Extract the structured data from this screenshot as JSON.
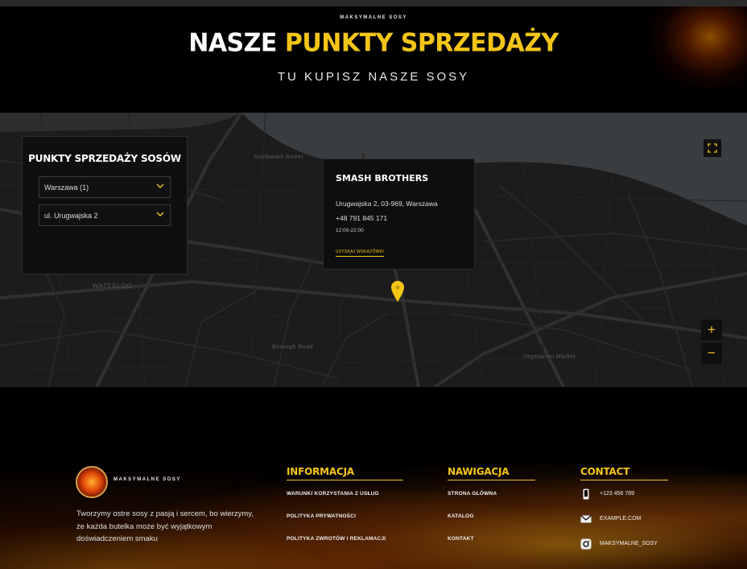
{
  "hero": {
    "brand": "MAKSYMALNE SOSY",
    "title_white": "NASZE",
    "title_yellow": "PUNKTY SPRZEDAŻY",
    "subtitle": "TU KUPISZ NASZE SOSY"
  },
  "map": {
    "labels": {
      "waterloo": "WATERLOO",
      "borough": "Borough Road",
      "vegetarian": "Vegetarian Market",
      "southwark": "Southwark Street"
    },
    "selector": {
      "title": "PUNKTY SPRZEDAŻY SOSÓW",
      "city_value": "Warszawa (1)",
      "street_value": "ul. Urugwajska 2"
    },
    "store": {
      "name": "SMASH BROTHERS",
      "address": "Urugwajska 2, 03-969, Warszawa",
      "phone": "+48 791 845 171",
      "hours": "12:00-22:00",
      "directions_label": "UZYSKAJ WSKAZÓWKI"
    },
    "zoom_in": "+",
    "zoom_out": "−"
  },
  "footer": {
    "brand": "MAKSYMALNE SOSY",
    "description": "Tworzymy ostre sosy z pasją i sercem, bo wierzymy, że każda butelka może być wyjątkowym doświadczeniem smaku",
    "info": {
      "heading": "INFORMACJA",
      "links": [
        "WARUNKI KORZYSTANIA Z USŁUG",
        "POLITYKA PRYWATNOŚCI",
        "POLITYKA ZWROTÓW I REKLAMACJI"
      ]
    },
    "nav": {
      "heading": "NAWIGACJA",
      "links": [
        "STRONA GŁÓWNA",
        "KATALOG",
        "KONTAKT"
      ]
    },
    "contact": {
      "heading": "CONTACT",
      "phone": "+123 456 789",
      "email": "EXAMPLE.COM",
      "instagram": "MAKSYMALNE_SOSY"
    }
  },
  "colors": {
    "accent": "#f5c518",
    "background": "#000000",
    "map_bg": "#1b1b1b",
    "river": "#3a3d40"
  },
  "icons": [
    "fullscreen-icon",
    "map-pin-icon",
    "chevron-down-icon",
    "phone-icon",
    "mail-icon",
    "instagram-icon"
  ]
}
